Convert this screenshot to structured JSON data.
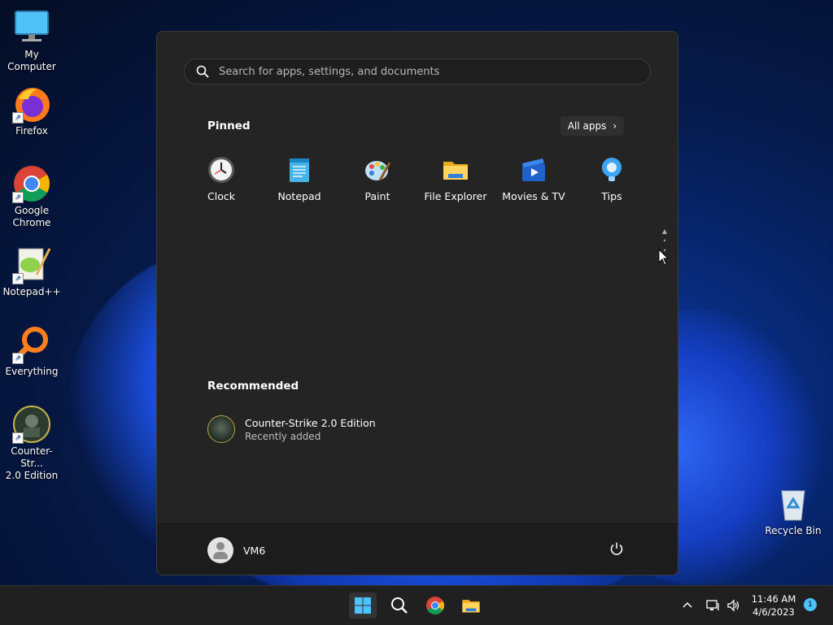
{
  "desktop": {
    "icons": [
      {
        "label": "My Computer",
        "icon": "monitor-icon"
      },
      {
        "label": "Firefox",
        "icon": "firefox-icon"
      },
      {
        "label": "Google Chrome",
        "icon": "chrome-icon"
      },
      {
        "label": "Notepad++",
        "icon": "notepadpp-icon"
      },
      {
        "label": "Everything",
        "icon": "everything-search-icon"
      },
      {
        "label": "Counter-Strike 2.0 Edition",
        "icon": "counter-strike-icon"
      },
      {
        "label": "Recycle Bin",
        "icon": "recycle-bin-icon"
      }
    ],
    "icon_label_lines": {
      "google_chrome_1": "Google",
      "google_chrome_2": "Chrome",
      "cs_1": "Counter-Str...",
      "cs_2": "2.0 Edition"
    }
  },
  "start_menu": {
    "search": {
      "placeholder": "Search for apps, settings, and documents"
    },
    "pinned": {
      "title": "Pinned",
      "all_apps_label": "All apps",
      "apps": [
        {
          "label": "Clock",
          "icon": "clock-icon"
        },
        {
          "label": "Notepad",
          "icon": "notepad-icon"
        },
        {
          "label": "Paint",
          "icon": "paint-icon"
        },
        {
          "label": "File Explorer",
          "icon": "folder-icon"
        },
        {
          "label": "Movies & TV",
          "icon": "movies-tv-icon"
        },
        {
          "label": "Tips",
          "icon": "lightbulb-icon"
        }
      ]
    },
    "recommended": {
      "title": "Recommended",
      "items": [
        {
          "title": "Counter-Strike 2.0 Edition",
          "subtitle": "Recently added",
          "icon": "counter-strike-icon"
        }
      ]
    },
    "user": {
      "name": "VM6"
    }
  },
  "taskbar": {
    "apps": [
      "start-icon",
      "search-icon",
      "chrome-icon",
      "file-explorer-icon"
    ],
    "tray": {
      "time": "11:46 AM",
      "date": "4/6/2023",
      "notification_count": "1"
    }
  },
  "colors": {
    "accent": "#4cc2ff",
    "start_bg": "#242424",
    "taskbar_bg": "#202020"
  }
}
